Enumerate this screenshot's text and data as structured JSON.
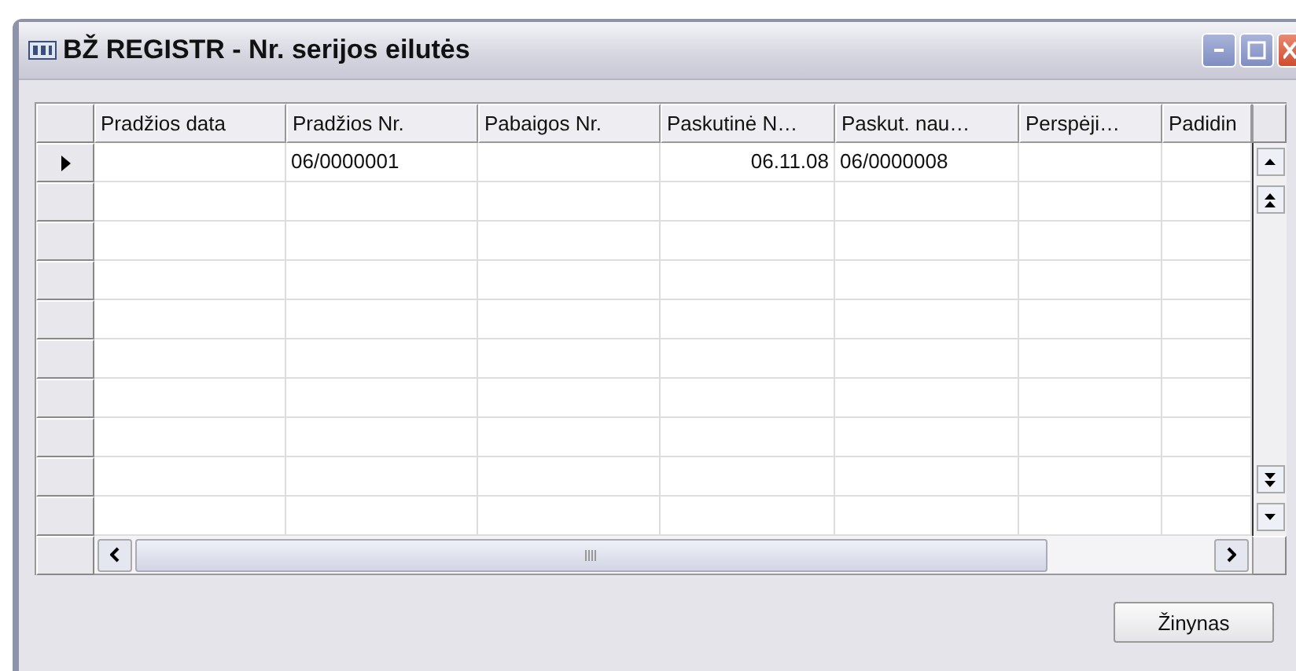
{
  "window": {
    "title": "BŽ REGISTR - Nr. serijos eilutės"
  },
  "table": {
    "columns": [
      "Pradžios data",
      "Pradžios Nr.",
      "Pabaigos Nr.",
      "Paskutinė N…",
      "Paskut. nau…",
      "Perspėji…",
      "Padidin"
    ],
    "rows": [
      {
        "selected": true,
        "cells": [
          null,
          "06/0000001",
          null,
          "06.11.08",
          "06/0000008",
          null,
          null
        ]
      },
      {
        "selected": false
      },
      {
        "selected": false
      },
      {
        "selected": false
      },
      {
        "selected": false
      },
      {
        "selected": false
      },
      {
        "selected": false
      },
      {
        "selected": false
      },
      {
        "selected": false
      },
      {
        "selected": false
      }
    ]
  },
  "buttons": [
    "Žinynas"
  ]
}
